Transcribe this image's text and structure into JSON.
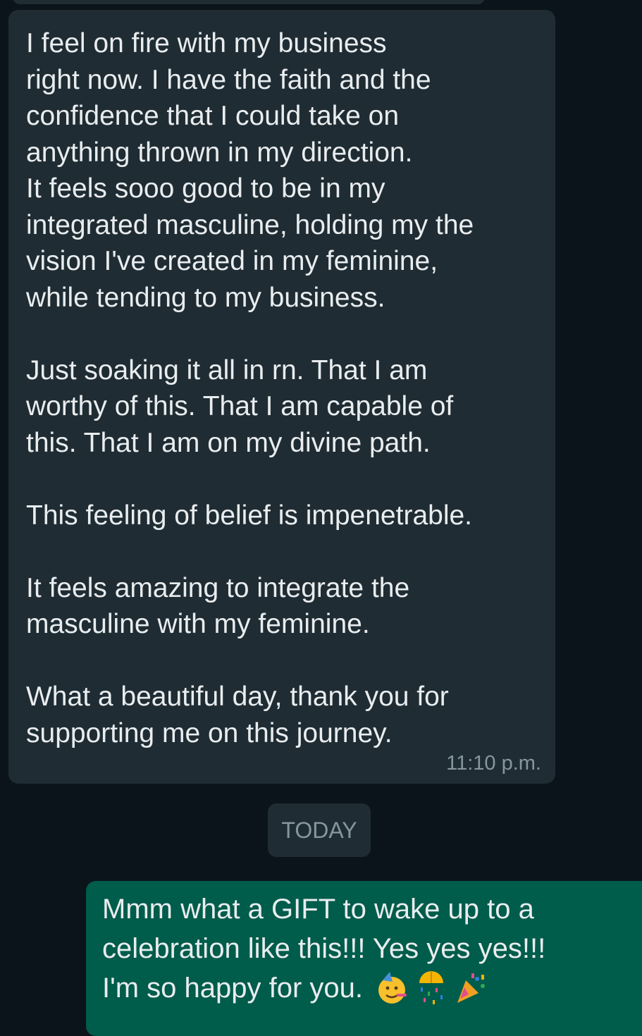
{
  "incoming_message": {
    "text": "I feel on fire with my business\nright now. I have the faith and the\nconfidence that I could take on\nanything thrown in my direction.\nIt feels sooo good to be in my\nintegrated masculine, holding my the\nvision I've created in my feminine,\nwhile tending to my business.\n\nJust soaking it all in rn. That I am\nworthy of this. That I am capable of\nthis. That I am on my divine path.\n\nThis feeling of belief is impenetrable.\n\nIt feels amazing to integrate the\nmasculine with my feminine.\n\nWhat a beautiful day, thank you for\nsupporting me on this journey.",
    "time": "11:10 p.m."
  },
  "date_separator": {
    "label": "TODAY"
  },
  "outgoing_message": {
    "line1": "Mmm what a GIFT to wake up to a",
    "line2": "celebration like this!!! Yes yes yes!!!",
    "line3": "I'm so happy for you.",
    "emojis": [
      "partying-face-icon",
      "confetti-ball-icon",
      "party-popper-icon"
    ]
  },
  "colors": {
    "background": "#0b141a",
    "incoming_bubble": "#1f2c33",
    "outgoing_bubble": "#005c4b",
    "text": "#e9edef",
    "meta_text": "#8696a0"
  }
}
